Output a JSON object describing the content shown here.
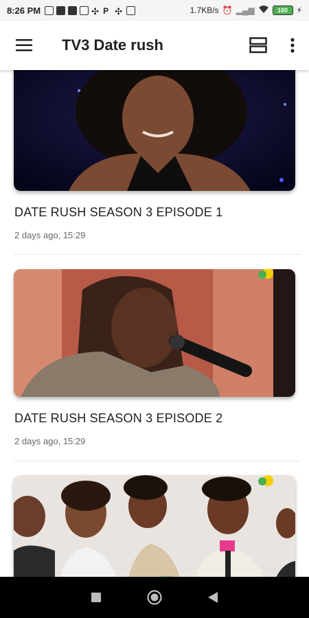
{
  "status_bar": {
    "time": "8:26 PM",
    "net_speed": "1.7KB/s",
    "battery": "100"
  },
  "app_bar": {
    "title": "TV3 Date rush"
  },
  "videos": [
    {
      "title": "DATE RUSH SEASON 3 EPISODE 1",
      "meta": "2 days ago, 15:29"
    },
    {
      "title": "DATE RUSH SEASON 3 EPISODE 2",
      "meta": "2 days ago, 15:29"
    },
    {
      "title": "",
      "meta": ""
    }
  ],
  "colors": {
    "accent": "#212121",
    "battery": "#4caf50",
    "navbar": "#000000"
  }
}
